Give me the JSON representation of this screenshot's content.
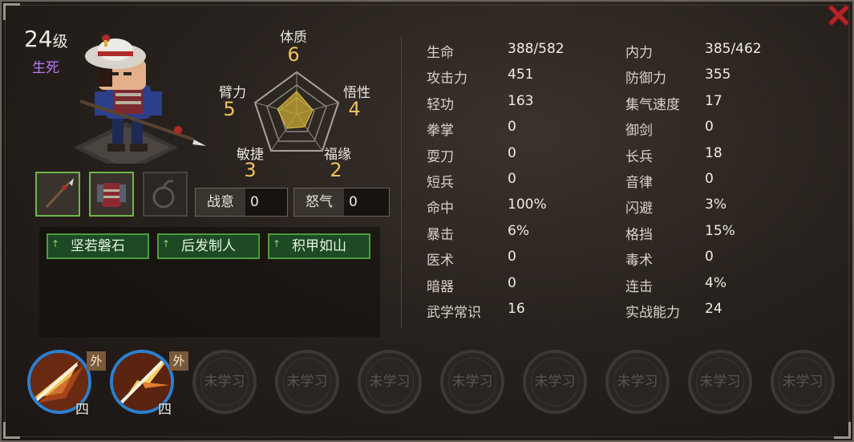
{
  "character": {
    "level": "24",
    "level_unit": "级",
    "realm": "生死"
  },
  "attributes": {
    "constitution": {
      "label": "体质",
      "value": "6"
    },
    "comprehension": {
      "label": "悟性",
      "value": "4"
    },
    "fortune": {
      "label": "福缘",
      "value": "2"
    },
    "agility": {
      "label": "敏捷",
      "value": "3"
    },
    "strength": {
      "label": "臂力",
      "value": "5"
    }
  },
  "gauges": {
    "battle_will": {
      "label": "战意",
      "value": "0"
    },
    "rage": {
      "label": "怒气",
      "value": "0"
    }
  },
  "traits": [
    {
      "label": "坚若磐石",
      "arrow": "↑"
    },
    {
      "label": "后发制人",
      "arrow": "↑"
    },
    {
      "label": "积甲如山",
      "arrow": "↑"
    }
  ],
  "stats_left": [
    {
      "name": "生命",
      "value": "388/582"
    },
    {
      "name": "攻击力",
      "value": "451"
    },
    {
      "name": "轻功",
      "value": "163"
    },
    {
      "name": "拳掌",
      "value": "0"
    },
    {
      "name": "耍刀",
      "value": "0"
    },
    {
      "name": "短兵",
      "value": "0"
    },
    {
      "name": "命中",
      "value": "100%"
    },
    {
      "name": "暴击",
      "value": "6%"
    },
    {
      "name": "医术",
      "value": "0"
    },
    {
      "name": "暗器",
      "value": "0"
    },
    {
      "name": "武学常识",
      "value": "16"
    }
  ],
  "stats_right": [
    {
      "name": "内力",
      "value": "385/462"
    },
    {
      "name": "防御力",
      "value": "355"
    },
    {
      "name": "集气速度",
      "value": "17"
    },
    {
      "name": "御剑",
      "value": "0"
    },
    {
      "name": "长兵",
      "value": "18"
    },
    {
      "name": "音律",
      "value": "0"
    },
    {
      "name": "闪避",
      "value": "3%"
    },
    {
      "name": "格挡",
      "value": "15%"
    },
    {
      "name": "毒术",
      "value": "0"
    },
    {
      "name": "连击",
      "value": "4%"
    },
    {
      "name": "实战能力",
      "value": "24"
    }
  ],
  "skills": [
    {
      "tag": "外",
      "rank": "四",
      "icon": "spear-thrust-icon"
    },
    {
      "tag": "外",
      "rank": "四",
      "icon": "spear-burst-icon"
    }
  ],
  "empty_slot_label": "未学习",
  "equipment": [
    "spear-icon",
    "armor-icon",
    "accessory-empty-icon"
  ],
  "colors": {
    "accent_blue": "#2d7fcf",
    "trait_green": "#1d4a24",
    "value_gold": "#eec25e",
    "realm_purple": "#b878f0"
  }
}
